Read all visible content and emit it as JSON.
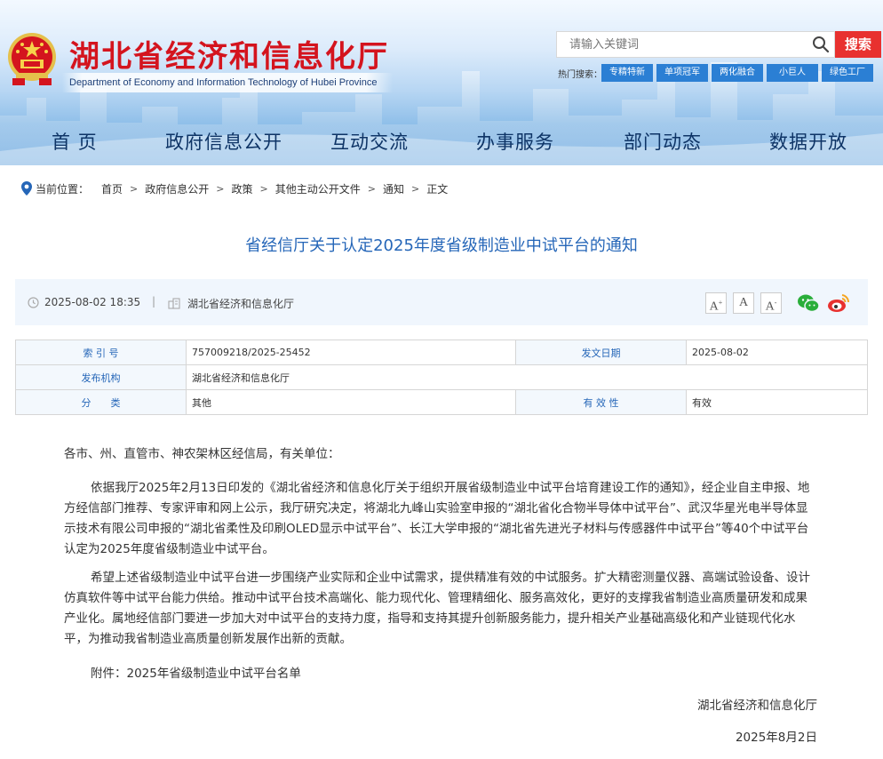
{
  "header": {
    "site_title": "湖北省经济和信息化厅",
    "site_subtitle": "Department of Economy and Information Technology of Hubei Province",
    "search_placeholder": "请输入关键词",
    "search_button": "搜索",
    "hot_label": "热门搜索：",
    "hot_tags": [
      "专精特新",
      "单项冠军",
      "两化融合",
      "小巨人",
      "绿色工厂"
    ]
  },
  "nav": {
    "items": [
      "首 页",
      "政府信息公开",
      "互动交流",
      "办事服务",
      "部门动态",
      "数据开放"
    ]
  },
  "breadcrumb": {
    "label": "当前位置：",
    "items": [
      "首页",
      "政府信息公开",
      "政策",
      "其他主动公开文件",
      "通知",
      "正文"
    ],
    "separator": ">"
  },
  "article": {
    "title": "省经信厅关于认定2025年度省级制造业中试平台的通知",
    "date": "2025-08-02 18:35",
    "divider": "|",
    "source": "湖北省经济和信息化厅",
    "font_sizes": [
      "A",
      "A",
      "A"
    ]
  },
  "info_table": {
    "index_label": "索 引 号",
    "index_value": "757009218/2025-25452",
    "date_label": "发文日期",
    "date_value": "2025-08-02",
    "org_label": "发布机构",
    "org_value": "湖北省经济和信息化厅",
    "category_label": "分　　类",
    "category_value": "其他",
    "validity_label": "有 效 性",
    "validity_value": "有效"
  },
  "body": {
    "greeting": "各市、州、直管市、神农架林区经信局，有关单位：",
    "para1": "依据我厅2025年2月13日印发的《湖北省经济和信息化厅关于组织开展省级制造业中试平台培育建设工作的通知》，经企业自主申报、地方经信部门推荐、专家评审和网上公示，我厅研究决定，将湖北九峰山实验室申报的“湖北省化合物半导体中试平台”、武汉华星光电半导体显示技术有限公司申报的“湖北省柔性及印刷OLED显示中试平台”、长江大学申报的“湖北省先进光子材料与传感器件中试平台”等40个中试平台认定为2025年度省级制造业中试平台。",
    "para2": "希望上述省级制造业中试平台进一步围绕产业实际和企业中试需求，提供精准有效的中试服务。扩大精密测量仪器、高端试验设备、设计仿真软件等中试平台能力供给。推动中试平台技术高端化、能力现代化、管理精细化、服务高效化，更好的支撑我省制造业高质量研发和成果产业化。属地经信部门要进一步加大对中试平台的支持力度，指导和支持其提升创新服务能力，提升相关产业基础高级化和产业链现代化水平，为推动我省制造业高质量创新发展作出新的贡献。",
    "attachment": "附件：2025年省级制造业中试平台名单",
    "signature": "湖北省经济和信息化厅",
    "sign_date": "2025年8月2日"
  },
  "colors": {
    "brand_red": "#d4141e",
    "link_blue": "#2566b8",
    "nav_blue": "#0e3466",
    "tag_blue": "#2b7fd4",
    "search_red": "#e8312f"
  }
}
